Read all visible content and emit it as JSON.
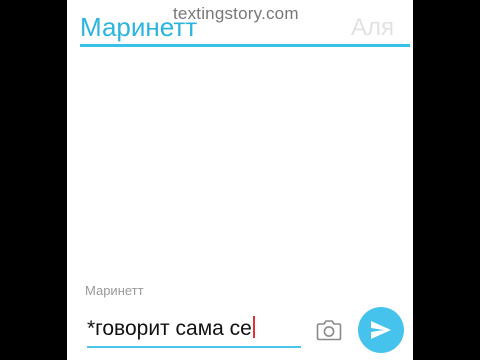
{
  "watermark": "textingstory.com",
  "tabs": [
    {
      "label": "Маринетт",
      "active": true
    },
    {
      "label": "Аля",
      "active": false
    }
  ],
  "composer": {
    "sender_label": "Маринетт",
    "input_value": "*говорит  сама се",
    "camera_icon": "camera-icon",
    "send_icon": "send-icon"
  },
  "colors": {
    "accent": "#2bb5de",
    "send_button": "#45c3ec",
    "inactive_tab": "#e2e2e2",
    "caret": "#e0303a"
  }
}
